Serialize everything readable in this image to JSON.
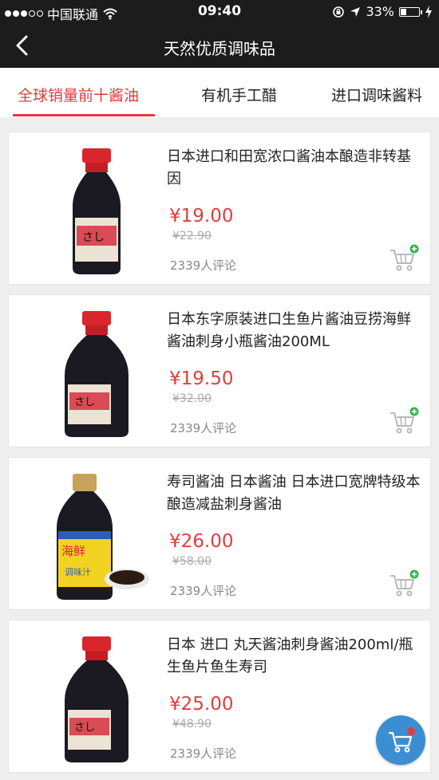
{
  "status_bar": {
    "carrier": "中国联通",
    "time": "09:40",
    "battery": "33%",
    "battery_level": 0.33
  },
  "nav": {
    "title": "天然优质调味品"
  },
  "tabs": [
    {
      "label": "全球销量前十酱油",
      "active": true
    },
    {
      "label": "有机手工醋",
      "active": false
    },
    {
      "label": "进口调味酱料",
      "active": false
    }
  ],
  "products": [
    {
      "name": "日本进口和田宽浓口酱油本酿造非转基因",
      "price": "¥19.00",
      "original_price": "¥22.90",
      "reviews": "2339人评论"
    },
    {
      "name": "日本东字原装进口生鱼片酱油豆捞海鲜酱油刺身小瓶酱油200ML",
      "price": "¥19.50",
      "original_price": "¥32.00",
      "reviews": "2339人评论"
    },
    {
      "name": "寿司酱油 日本酱油 日本进口宽牌特级本酿造减盐刺身酱油",
      "price": "¥26.00",
      "original_price": "¥58.00",
      "reviews": "2339人评论"
    },
    {
      "name": "日本 进口 丸天酱油刺身酱油200ml/瓶生鱼片鱼生寿司",
      "price": "¥25.00",
      "original_price": "¥48.90",
      "reviews": "2339人评论"
    }
  ],
  "colors": {
    "accent": "#e23d3d",
    "header_bg": "#1c1c1c",
    "fab": "#3b8ed1",
    "add_badge": "#2db84d"
  },
  "icons": {
    "back": "chevron-left-icon",
    "cart_add": "cart-add-icon",
    "floating_cart": "cart-icon"
  }
}
